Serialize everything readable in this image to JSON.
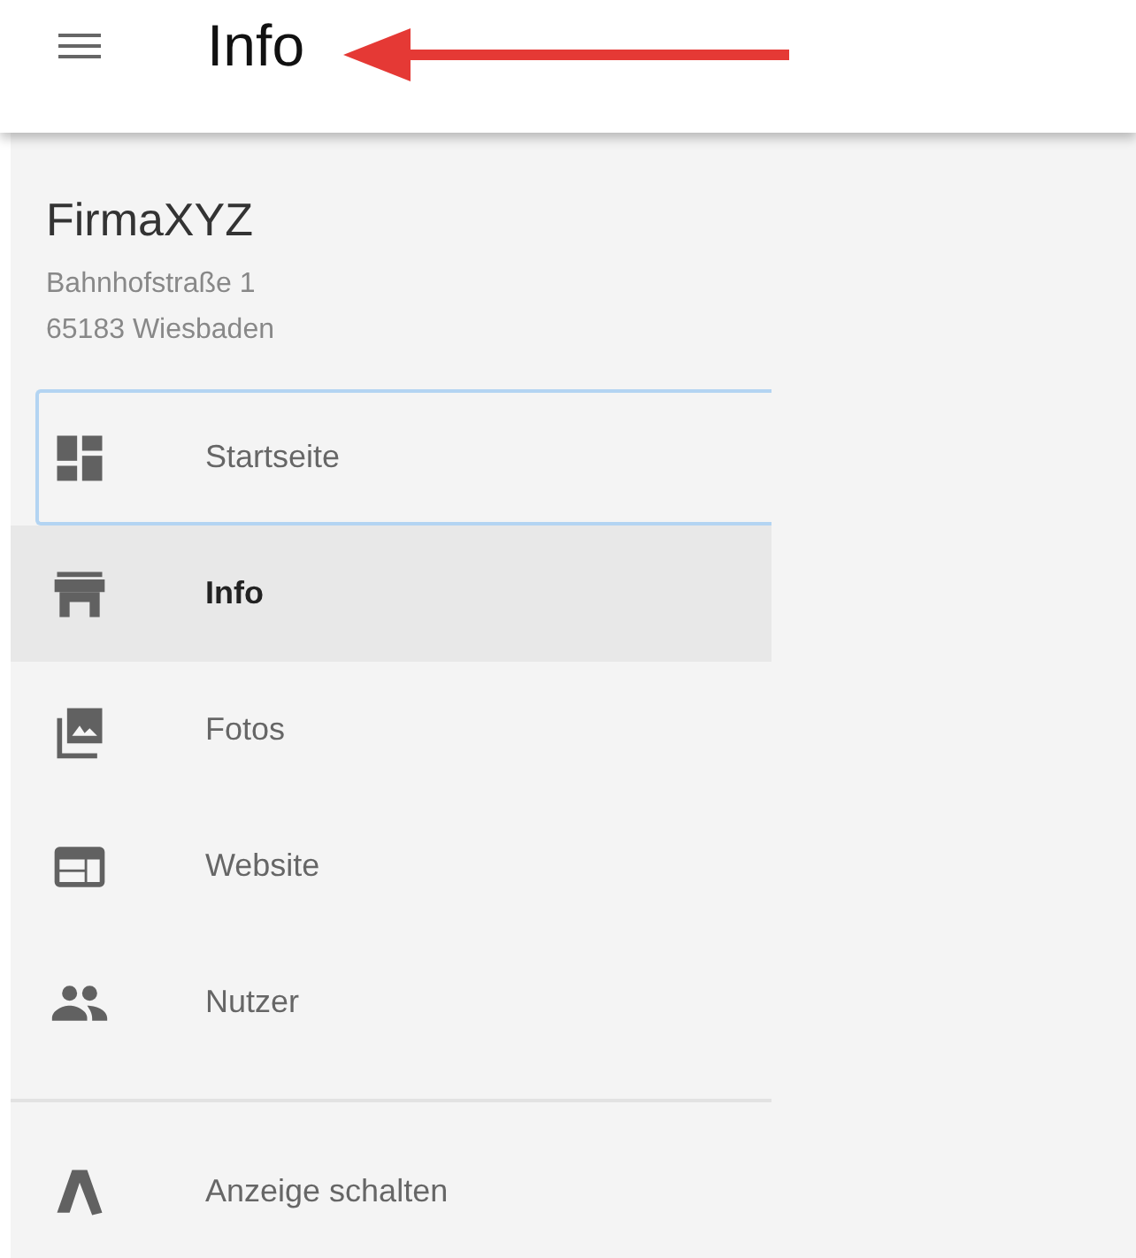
{
  "app_bar": {
    "title": "Info"
  },
  "annotation": {
    "kind": "arrow"
  },
  "business": {
    "name": "FirmaXYZ",
    "address_lines": [
      "Bahnhofstraße 1",
      "65183 Wiesbaden"
    ]
  },
  "nav_groups": [
    {
      "items": [
        {
          "label": "Startseite",
          "kind": "dashboard",
          "selected": false,
          "focused": true
        },
        {
          "label": "Info",
          "kind": "store",
          "selected": true,
          "focused": false
        },
        {
          "label": "Fotos",
          "kind": "photos",
          "selected": false,
          "focused": false
        },
        {
          "label": "Website",
          "kind": "website",
          "selected": false,
          "focused": false
        },
        {
          "label": "Nutzer",
          "kind": "people",
          "selected": false,
          "focused": false
        }
      ]
    },
    {
      "items": [
        {
          "label": "Anzeige schalten",
          "kind": "ads",
          "selected": false,
          "focused": false
        }
      ]
    }
  ]
}
